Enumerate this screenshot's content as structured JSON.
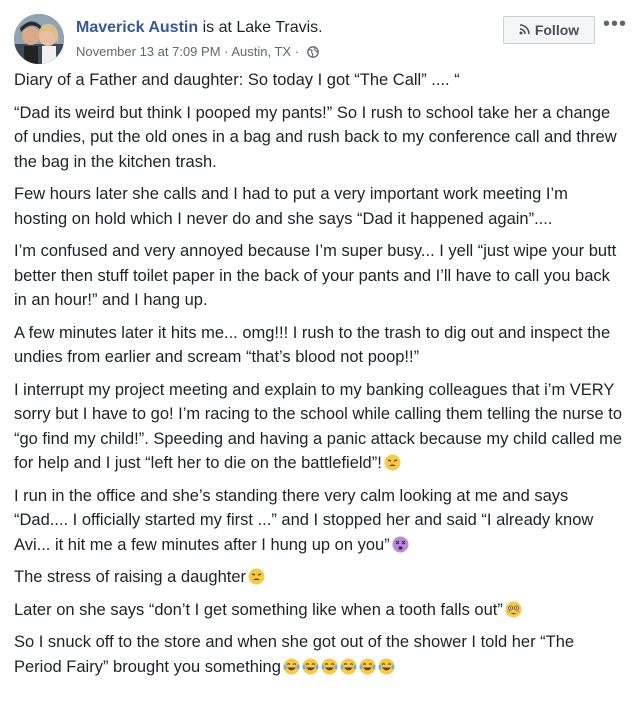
{
  "header": {
    "name": "Maverick Austin",
    "status": " is at ",
    "place": "Lake Travis.",
    "date": "November 13 at 7:09 PM",
    "separator": " · ",
    "location": "Austin, TX",
    "separator2": " · ",
    "privacy_icon": "globe-icon",
    "follow_label": "Follow",
    "follow_icon": "rss-icon",
    "more_label": "•••"
  },
  "post": {
    "paragraphs": [
      "Diary of a Father and daughter: So today I got “The Call” .... “",
      "“Dad its weird but think I pooped my pants!” So I rush to school take her a change of undies, put the old ones in a bag and rush back to my conference call and threw the bag in the kitchen trash.",
      "Few hours later she calls and I had to put a very important work meeting I’m hosting on hold which I never do and she says “Dad it happened again”....",
      "I’m confused and very annoyed because I’m super busy... I yell “just wipe your butt better then stuff toilet paper in the back of your pants and I’ll have to call you back in an hour!” and I hang up.",
      "A few minutes later it hits me... omg!!! I rush to the trash to dig out and inspect the undies from earlier and scream “that’s blood not poop!!”",
      "I interrupt my project meeting and explain to my banking colleagues that i’m VERY sorry but I have to go! I’m racing to the school while calling them telling the nurse to “go find my child!”. Speeding and having a panic attack because my child called me for help and I just “left her to die on the battlefield”!",
      "I run in the office and she’s standing there very calm looking at me and says “Dad.... I officially started my first ...” and I stopped her and said “I already know Avi... it hit me a few minutes after I hung up on you”",
      "The stress of raising a daughter",
      "Later on she says “don’t I get something like when a tooth falls out”",
      "So I snuck off to the store and when she got out of the shower I told her “The Period Fairy” brought you something"
    ],
    "emoji": {
      "p5": "weary-face-emoji",
      "p6": "dizzy-face-emoji",
      "p7": "weary-face-emoji",
      "p8": "flushed-face-emoji",
      "p9": "face-with-tears-of-joy-emoji x6"
    }
  }
}
